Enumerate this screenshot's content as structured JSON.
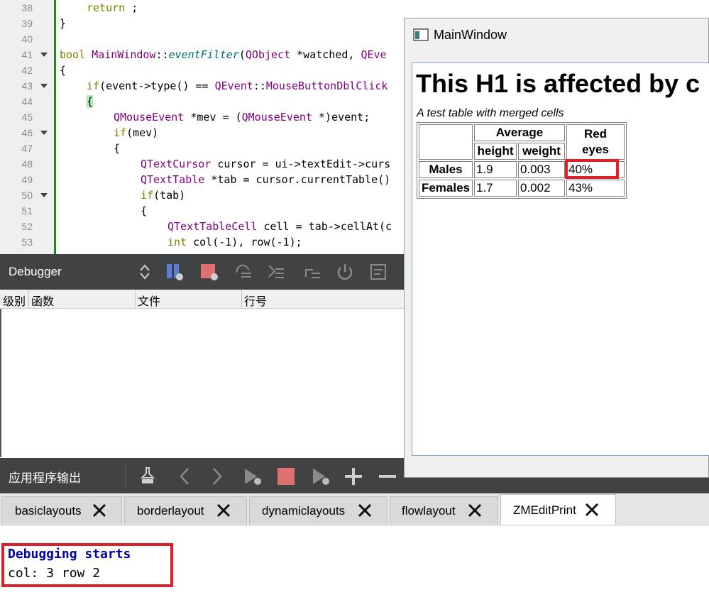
{
  "editor": {
    "lines": [
      {
        "n": "38",
        "fold": false
      },
      {
        "n": "39",
        "fold": false
      },
      {
        "n": "40",
        "fold": false
      },
      {
        "n": "41",
        "fold": true
      },
      {
        "n": "42",
        "fold": false
      },
      {
        "n": "43",
        "fold": true
      },
      {
        "n": "44",
        "fold": false
      },
      {
        "n": "45",
        "fold": false
      },
      {
        "n": "46",
        "fold": true
      },
      {
        "n": "47",
        "fold": false
      },
      {
        "n": "48",
        "fold": false
      },
      {
        "n": "49",
        "fold": false
      },
      {
        "n": "50",
        "fold": true
      },
      {
        "n": "51",
        "fold": false
      },
      {
        "n": "52",
        "fold": false
      },
      {
        "n": "53",
        "fold": false
      }
    ],
    "code": {
      "l38_kw": "return",
      "l38_rest": " ;",
      "l39": "}",
      "l41_kw": "bool",
      "l41_cls": "MainWindow",
      "l41_sep": "::",
      "l41_fn": "eventFilter",
      "l41_p1": "(",
      "l41_ty": "QObject",
      "l41_p2": " *watched, ",
      "l41_ty2": "QEve",
      "l42": "{",
      "l43_kw": "if",
      "l43_a": "(event->type() == ",
      "l43_ty": "QEvent",
      "l43_sep": "::",
      "l43_en": "MouseButtonDblClick",
      "l44": "{",
      "l45_ty": "QMouseEvent",
      "l45_a": " *mev = (",
      "l45_ty2": "QMouseEvent",
      "l45_b": " *)event;",
      "l46_kw": "if",
      "l46_a": "(mev)",
      "l47": "{",
      "l48_ty": "QTextCursor",
      "l48_a": " cursor = ui->textEdit->curs",
      "l49_ty": "QTextTable",
      "l49_a": " *tab = cursor.currentTable()",
      "l50_kw": "if",
      "l50_a": "(tab)",
      "l51": "{",
      "l52_ty": "QTextTableCell",
      "l52_a": " cell = tab->cellAt(c",
      "l53_kw": "int",
      "l53_a": " col(-1), row(-1);"
    }
  },
  "debugger": {
    "title": "Debugger",
    "columns": [
      "级别",
      "函数",
      "文件",
      "行号"
    ]
  },
  "app_output": {
    "title": "应用程序输出",
    "tabs": [
      {
        "label": "basiclayouts",
        "active": false
      },
      {
        "label": "borderlayout",
        "active": false
      },
      {
        "label": "dynamiclayouts",
        "active": false
      },
      {
        "label": "flowlayout",
        "active": false
      },
      {
        "label": "ZMEditPrint",
        "active": true
      }
    ],
    "lines": [
      "Debugging starts",
      "col: 3 row 2"
    ]
  },
  "main_window": {
    "title": "MainWindow",
    "h1": "This H1 is affected by c",
    "caption": "A test table with merged cells",
    "table": {
      "average": "Average",
      "red_eyes_1": "Red",
      "red_eyes_2": "eyes",
      "height": "height",
      "weight": "weight",
      "rows": [
        {
          "label": "Males",
          "height": "1.9",
          "weight": "0.003",
          "red": "40%"
        },
        {
          "label": "Females",
          "height": "1.7",
          "weight": "0.002",
          "red": "43%"
        }
      ]
    }
  },
  "colors": {
    "toolbar": "#404244",
    "highlight": "#e0202a",
    "keyword": "#808000",
    "type": "#800080"
  }
}
